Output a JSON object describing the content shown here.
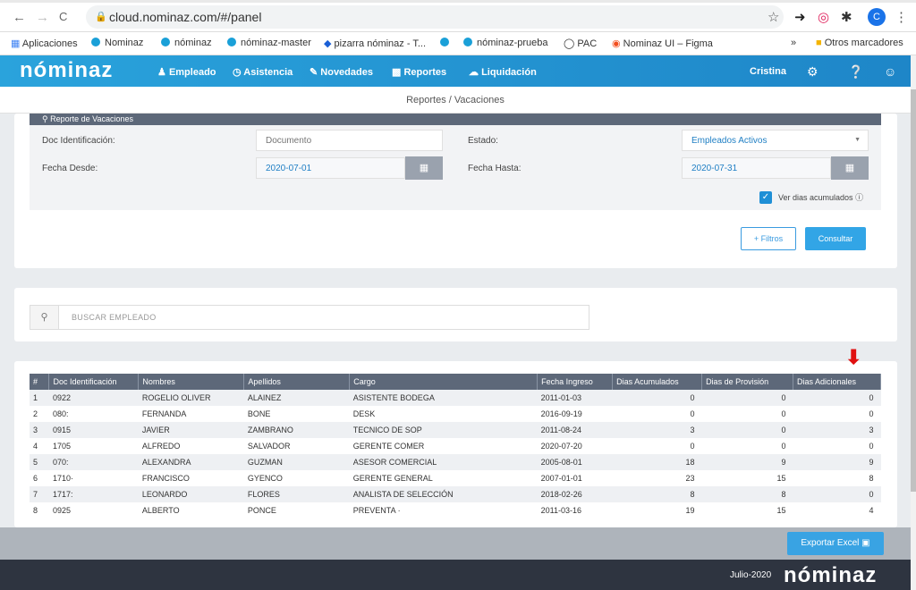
{
  "browser": {
    "url": "cloud.nominaz.com/#/panel",
    "back": "←",
    "forward": "→",
    "reload": "C",
    "avatar_letter": "C"
  },
  "bookmarks": [
    {
      "label": "Aplicaciones"
    },
    {
      "label": "Nominaz"
    },
    {
      "label": "nóminaz"
    },
    {
      "label": "nóminaz-master"
    },
    {
      "label": "pizarra nóminaz - T..."
    },
    {
      "label": ""
    },
    {
      "label": "nóminaz-prueba"
    },
    {
      "label": "PAC"
    },
    {
      "label": "Nominaz UI – Figma"
    }
  ],
  "bookmarks_more": "»",
  "bookmarks_other": "Otros marcadores",
  "header": {
    "logo": "nóminaz",
    "nav": [
      "Empleado",
      "Asistencia",
      "Novedades",
      "Reportes",
      "Liquidación"
    ],
    "user": "Cristina"
  },
  "breadcrumb": "Reportes / Vacaciones",
  "filters": {
    "title": "Reporte de Vacaciones",
    "doc_label": "Doc Identificación:",
    "doc_placeholder": "Documento",
    "estado_label": "Estado:",
    "estado_value": "Empleados Activos",
    "fecha_desde_label": "Fecha Desde:",
    "fecha_desde_value": "2020-07-01",
    "fecha_hasta_label": "Fecha Hasta:",
    "fecha_hasta_value": "2020-07-31",
    "ver_dias_label": "Ver dias acumulados",
    "ver_dias_checked": true,
    "filtros_button": "+ Filtros",
    "consultar_button": "Consultar"
  },
  "search": {
    "placeholder": "BUSCAR EMPLEADO"
  },
  "table": {
    "headers": [
      "#",
      "Doc Identificación",
      "Nombres",
      "Apellidos",
      "Cargo",
      "Fecha Ingreso",
      "Dias Acumulados",
      "Dias de Provisión",
      "Dias Adicionales"
    ],
    "rows": [
      [
        "1",
        "0922",
        "ROGELIO OLIVER",
        "ALAINEZ",
        "ASISTENTE BODEGA",
        "2011-01-03",
        "0",
        "0",
        "0"
      ],
      [
        "2",
        "080:",
        "FERNANDA",
        "BONE",
        "DESK",
        "2016-09-19",
        "0",
        "0",
        "0"
      ],
      [
        "3",
        "0915",
        "JAVIER",
        "ZAMBRANO",
        "TECNICO DE SOP",
        "2011-08-24",
        "3",
        "0",
        "3"
      ],
      [
        "4",
        "1705",
        "ALFREDO",
        "SALVADOR",
        "GERENTE COMER",
        "2020-07-20",
        "0",
        "0",
        "0"
      ],
      [
        "5",
        "070:",
        "ALEXANDRA",
        "GUZMAN",
        "ASESOR COMERCIAL",
        "2005-08-01",
        "18",
        "9",
        "9"
      ],
      [
        "6",
        "1710·",
        "FRANCISCO",
        "GYENCO",
        "GERENTE GENERAL",
        "2007-01-01",
        "23",
        "15",
        "8"
      ],
      [
        "7",
        "1717:",
        "LEONARDO",
        "FLORES",
        "ANALISTA DE SELECCIÓN",
        "2018-02-26",
        "8",
        "8",
        "0"
      ],
      [
        "8",
        "0925",
        "ALBERTO",
        "PONCE",
        "PREVENTA ·",
        "2011-03-16",
        "19",
        "15",
        "4"
      ]
    ]
  },
  "export_button": "Exportar Excel",
  "footer": {
    "date": "Julio-2020",
    "logo": "nóminaz"
  }
}
